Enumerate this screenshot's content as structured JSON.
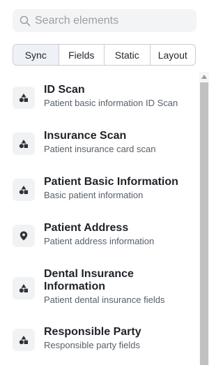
{
  "search": {
    "placeholder": "Search elements",
    "icon": "search-icon"
  },
  "tabs": [
    {
      "label": "Sync",
      "active": true
    },
    {
      "label": "Fields",
      "active": false
    },
    {
      "label": "Static",
      "active": false
    },
    {
      "label": "Layout",
      "active": false
    }
  ],
  "items": [
    {
      "title": "ID Scan",
      "description": "Patient basic information ID Scan",
      "icon": "shapes-icon"
    },
    {
      "title": "Insurance Scan",
      "description": "Patient insurance card scan",
      "icon": "shapes-icon"
    },
    {
      "title": "Patient Basic Information",
      "description": "Basic patient information",
      "icon": "shapes-icon"
    },
    {
      "title": "Patient Address",
      "description": "Patient address information",
      "icon": "location-pin-icon"
    },
    {
      "title": "Dental Insurance Information",
      "description": "Patient dental insurance fields",
      "icon": "shapes-icon"
    },
    {
      "title": "Responsible Party",
      "description": "Responsible party fields",
      "icon": "shapes-icon"
    }
  ],
  "colors": {
    "background": "#ffffff",
    "search_bg": "#f3f4f6",
    "tab_active_bg": "#eef1f5",
    "icon_bg": "#f1f2f4",
    "title_text": "#1f2328",
    "description_text": "#57606a",
    "scroll_thumb": "#c1c1c1"
  }
}
